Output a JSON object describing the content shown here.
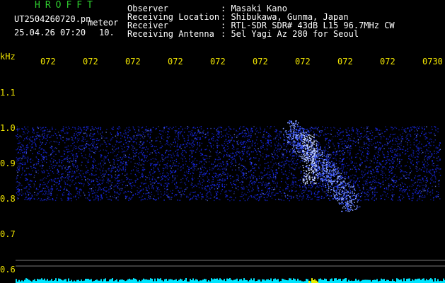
{
  "app": {
    "logo": "HROFFT",
    "filename": "UT2504260720.pn",
    "meteor_label": "meteor",
    "datetime": "25.04.26 07:20",
    "count": "10."
  },
  "info": {
    "labels": [
      "Observer",
      "Receiving Location",
      "Receiver",
      "Receiving Antenna"
    ],
    "values": [
      ": Masaki Kano",
      ": Shibukawa, Gunma, Japan",
      ": RTL-SDR SDR# 43dB L15 96.7MHz CW",
      ": 5el Yagi Az 280 for Seoul"
    ]
  },
  "axes": {
    "y_unit": "kHz",
    "y_ticks": [
      "1.1",
      "1.0",
      "0.9",
      "0.8",
      "0.7",
      "0.6"
    ],
    "x_ticks": [
      "072",
      "072",
      "072",
      "072",
      "072",
      "072",
      "072",
      "072",
      "072",
      "0730"
    ]
  },
  "colors": {
    "background": "#000000",
    "noise": "#1a2cff",
    "meteor": "#8fa6ff",
    "axis_text": "#f2e600",
    "logo": "#2ecc2e",
    "baseline": "#00e5ff"
  }
}
